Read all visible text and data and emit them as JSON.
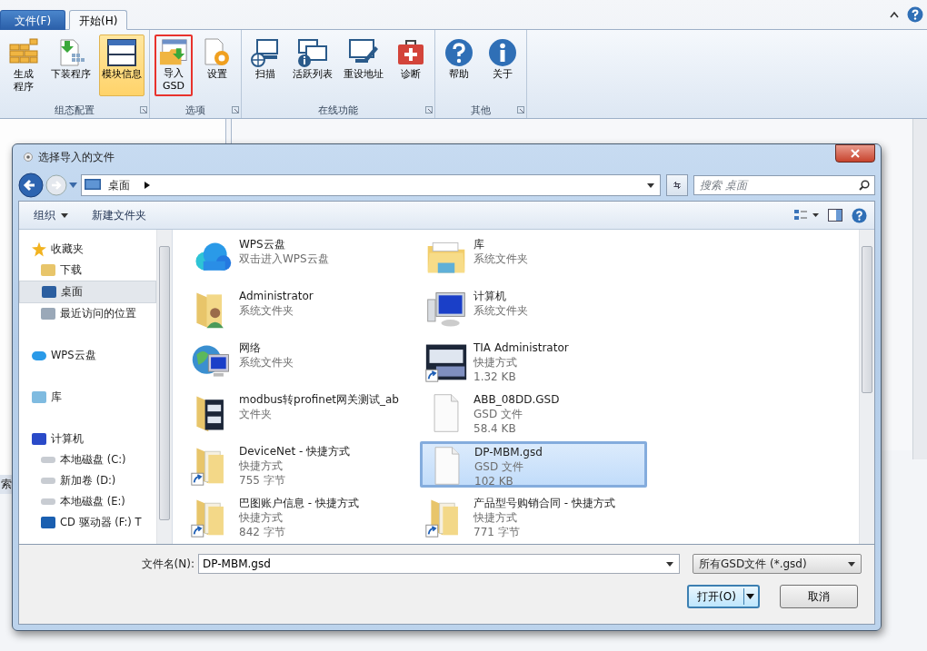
{
  "ribbon": {
    "tabs": [
      {
        "label": "文件(F)",
        "kind": "menu",
        "selected": false
      },
      {
        "label": "开始(H)",
        "kind": "tab",
        "selected": true
      }
    ],
    "groups": [
      {
        "title": "组态配置",
        "buttons": [
          {
            "lines": [
              "生成",
              "程序"
            ],
            "selected": false,
            "highlighted": false
          },
          {
            "lines": [
              "下装程序"
            ],
            "selected": false,
            "highlighted": false
          },
          {
            "lines": [
              "模块信息"
            ],
            "selected": true,
            "highlighted": false
          }
        ]
      },
      {
        "title": "选项",
        "buttons": [
          {
            "lines": [
              "导入",
              "GSD"
            ],
            "selected": false,
            "highlighted": true
          },
          {
            "lines": [
              "设置"
            ],
            "selected": false,
            "highlighted": false
          }
        ]
      },
      {
        "title": "在线功能",
        "buttons": [
          {
            "lines": [
              "扫描"
            ],
            "selected": false,
            "highlighted": false
          },
          {
            "lines": [
              "活跃列表"
            ],
            "selected": false,
            "highlighted": false
          },
          {
            "lines": [
              "重设地址"
            ],
            "selected": false,
            "highlighted": false
          },
          {
            "lines": [
              "诊断"
            ],
            "selected": false,
            "highlighted": false
          }
        ]
      },
      {
        "title": "其他",
        "buttons": [
          {
            "lines": [
              "帮助"
            ],
            "selected": false,
            "highlighted": false
          },
          {
            "lines": [
              "关于"
            ],
            "selected": false,
            "highlighted": false
          }
        ]
      }
    ]
  },
  "background": {
    "fragment": "索"
  },
  "dialog": {
    "title": "选择导入的文件",
    "address": "桌面",
    "search": {
      "placeholder": "搜索 桌面"
    },
    "toolbar": [
      {
        "label": "组织",
        "kind": "menu"
      },
      {
        "label": "新建文件夹",
        "kind": "plain"
      }
    ],
    "nav": [
      {
        "label": "收藏夹",
        "selected": false,
        "children": [
          {
            "label": "下载",
            "selected": false
          },
          {
            "label": "桌面",
            "selected": true
          },
          {
            "label": "最近访问的位置",
            "selected": false
          }
        ]
      },
      {
        "label": "WPS云盘",
        "selected": false
      },
      {
        "label": "库",
        "selected": false
      },
      {
        "label": "计算机",
        "selected": false,
        "children": [
          {
            "label": "本地磁盘 (C:)",
            "selected": false
          },
          {
            "label": "新加卷 (D:)",
            "selected": false
          },
          {
            "label": "本地磁盘 (E:)",
            "selected": false
          },
          {
            "label": "CD 驱动器 (F:) T",
            "selected": false
          }
        ]
      }
    ],
    "files": [
      {
        "name": "WPS云盘",
        "lines": [
          "双击进入WPS云盘"
        ],
        "shortcut": false,
        "selected": false,
        "highlighted": false
      },
      {
        "name": "库",
        "lines": [
          "系统文件夹"
        ],
        "shortcut": false,
        "selected": false,
        "highlighted": false
      },
      {
        "name": "Administrator",
        "lines": [
          "系统文件夹"
        ],
        "shortcut": false,
        "selected": false,
        "highlighted": false
      },
      {
        "name": "计算机",
        "lines": [
          "系统文件夹"
        ],
        "shortcut": false,
        "selected": false,
        "highlighted": false
      },
      {
        "name": "网络",
        "lines": [
          "系统文件夹"
        ],
        "shortcut": false,
        "selected": false,
        "highlighted": false
      },
      {
        "name": "TIA Administrator",
        "lines": [
          "快捷方式",
          "1.32 KB"
        ],
        "shortcut": true,
        "selected": false,
        "highlighted": false
      },
      {
        "name": "modbus转profinet网关测试_ab",
        "lines": [
          "文件夹"
        ],
        "shortcut": false,
        "selected": false,
        "highlighted": false
      },
      {
        "name": "ABB_08DD.GSD",
        "lines": [
          "GSD 文件",
          "58.4 KB"
        ],
        "shortcut": false,
        "selected": false,
        "highlighted": false
      },
      {
        "name": "DeviceNet - 快捷方式",
        "lines": [
          "快捷方式",
          "755 字节"
        ],
        "shortcut": true,
        "selected": false,
        "highlighted": false
      },
      {
        "name": "DP-MBM.gsd",
        "lines": [
          "GSD 文件",
          "102 KB"
        ],
        "shortcut": false,
        "selected": true,
        "highlighted": true
      },
      {
        "name": "巴图账户信息 - 快捷方式",
        "lines": [
          "快捷方式",
          "842 字节"
        ],
        "shortcut": true,
        "selected": false,
        "highlighted": false
      },
      {
        "name": "产品型号购销合同 - 快捷方式",
        "lines": [
          "快捷方式",
          "771 字节"
        ],
        "shortcut": true,
        "selected": false,
        "highlighted": false
      }
    ],
    "filename": {
      "label": "文件名(N):",
      "value": "DP-MBM.gsd"
    },
    "filter": "所有GSD文件 (*.gsd)",
    "buttons": [
      {
        "label": "打开(O)",
        "kind": "split",
        "highlighted": true
      },
      {
        "label": "取消",
        "kind": "plain",
        "highlighted": false
      }
    ]
  }
}
